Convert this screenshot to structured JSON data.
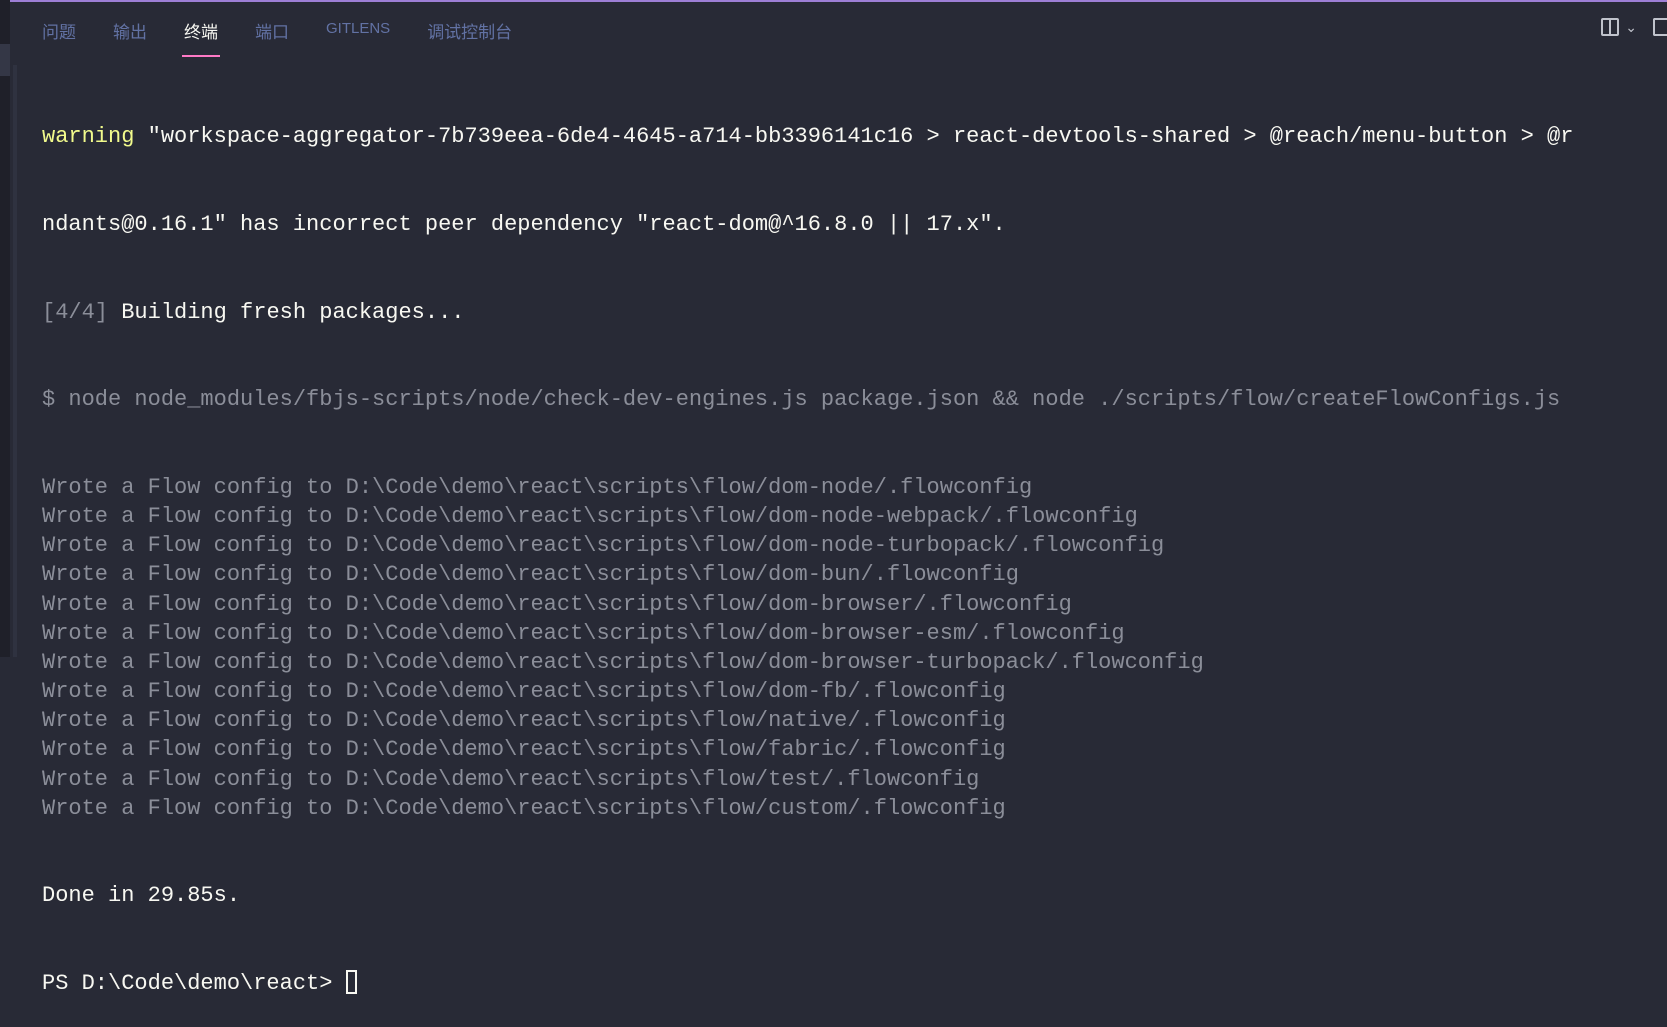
{
  "panel": {
    "tabs": [
      {
        "label": "问题"
      },
      {
        "label": "输出"
      },
      {
        "label": "终端",
        "active": true
      },
      {
        "label": "端口"
      },
      {
        "label": "GITLENS"
      },
      {
        "label": "调试控制台"
      }
    ],
    "icons": [
      "split-terminal-icon",
      "chevron-down-icon",
      "maximize-panel-icon"
    ]
  },
  "terminal": {
    "warning_keyword": "warning",
    "warning_line1": " \"workspace-aggregator-7b739eea-6de4-4645-a714-bb3396141c16 > react-devtools-shared > @reach/menu-button > @r",
    "warning_line2": "ndants@0.16.1\" has incorrect peer dependency \"react-dom@^16.8.0 || 17.x\".",
    "step_prefix": "[4/4]",
    "step_text": " Building fresh packages...",
    "command": "$ node node_modules/fbjs-scripts/node/check-dev-engines.js package.json && node ./scripts/flow/createFlowConfigs.js",
    "wrote_lines": [
      "Wrote a Flow config to D:\\Code\\demo\\react\\scripts\\flow/dom-node/.flowconfig",
      "Wrote a Flow config to D:\\Code\\demo\\react\\scripts\\flow/dom-node-webpack/.flowconfig",
      "Wrote a Flow config to D:\\Code\\demo\\react\\scripts\\flow/dom-node-turbopack/.flowconfig",
      "Wrote a Flow config to D:\\Code\\demo\\react\\scripts\\flow/dom-bun/.flowconfig",
      "Wrote a Flow config to D:\\Code\\demo\\react\\scripts\\flow/dom-browser/.flowconfig",
      "Wrote a Flow config to D:\\Code\\demo\\react\\scripts\\flow/dom-browser-esm/.flowconfig",
      "Wrote a Flow config to D:\\Code\\demo\\react\\scripts\\flow/dom-browser-turbopack/.flowconfig",
      "Wrote a Flow config to D:\\Code\\demo\\react\\scripts\\flow/dom-fb/.flowconfig",
      "Wrote a Flow config to D:\\Code\\demo\\react\\scripts\\flow/native/.flowconfig",
      "Wrote a Flow config to D:\\Code\\demo\\react\\scripts\\flow/fabric/.flowconfig",
      "Wrote a Flow config to D:\\Code\\demo\\react\\scripts\\flow/test/.flowconfig",
      "Wrote a Flow config to D:\\Code\\demo\\react\\scripts\\flow/custom/.flowconfig"
    ],
    "done": "Done in 29.85s.",
    "prompt": "PS D:\\Code\\demo\\react> "
  },
  "colors": {
    "background": "#282a36",
    "accent": "#ff79c6",
    "warning": "#f1fa8c",
    "dim": "#8b8e99"
  }
}
